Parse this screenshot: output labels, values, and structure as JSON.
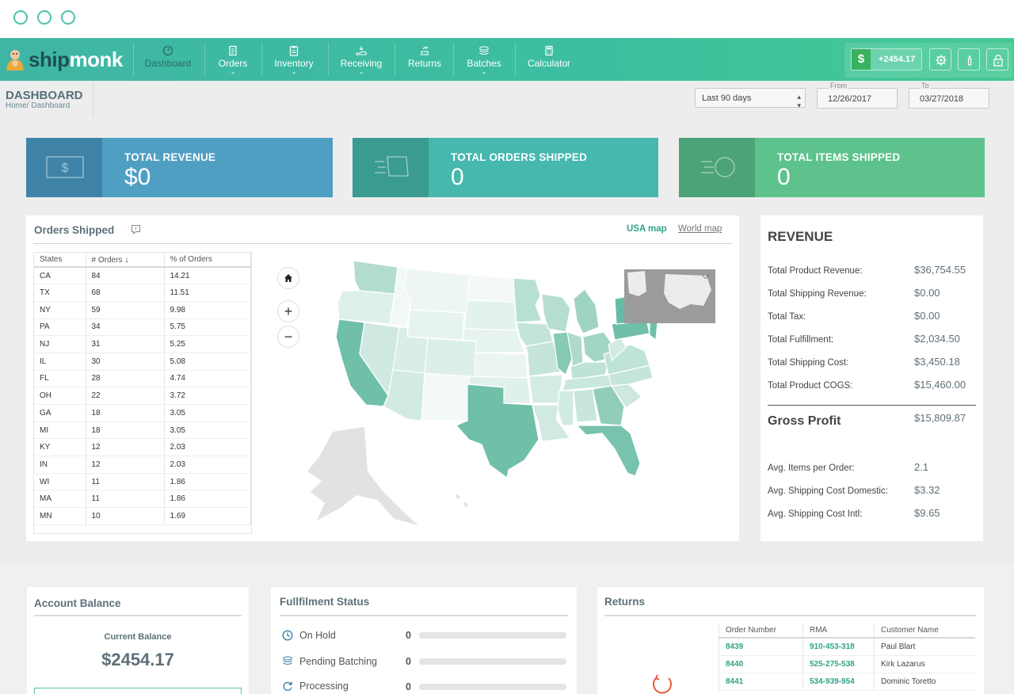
{
  "window": {
    "controls": [
      "close",
      "minimize",
      "maximize"
    ]
  },
  "brand": {
    "name_dark": "ship",
    "name_light": "monk"
  },
  "nav": {
    "items": [
      {
        "label": "Dashboard",
        "icon": "dashboard-gauge-icon",
        "active": true,
        "dropdown": false
      },
      {
        "label": "Orders",
        "icon": "document-icon",
        "active": false,
        "dropdown": true
      },
      {
        "label": "Inventory",
        "icon": "clipboard-icon",
        "active": false,
        "dropdown": true
      },
      {
        "label": "Receiving",
        "icon": "hand-receive-icon",
        "active": false,
        "dropdown": true
      },
      {
        "label": "Returns",
        "icon": "return-box-icon",
        "active": false,
        "dropdown": true
      },
      {
        "label": "Batches",
        "icon": "stack-icon",
        "active": false,
        "dropdown": true
      },
      {
        "label": "Calculator",
        "icon": "calculator-icon",
        "active": false,
        "dropdown": false
      }
    ],
    "balance": "+2454.17",
    "balance_symbol": "$"
  },
  "header": {
    "title": "DASHBOARD",
    "breadcrumb_home": "Home/",
    "breadcrumb_current": " Dashboard",
    "range": "Last 90 days",
    "from_label": "From",
    "from": "12/26/2017",
    "to_label": "To",
    "to": "03/27/2018"
  },
  "kpis": {
    "revenue": {
      "title": "TOTAL REVENUE",
      "value": "$0"
    },
    "orders": {
      "title": "TOTAL ORDERS SHIPPED",
      "value": "0"
    },
    "items": {
      "title": "TOTAL ITEMS SHIPPED",
      "value": "0"
    }
  },
  "orders_shipped": {
    "title": "Orders Shipped",
    "tab_usa": "USA map",
    "tab_world": "World map",
    "columns": [
      "States",
      "# Orders",
      "% of Orders"
    ],
    "rows": [
      [
        "CA",
        "84",
        "14.21"
      ],
      [
        "TX",
        "68",
        "11.51"
      ],
      [
        "NY",
        "59",
        "9.98"
      ],
      [
        "PA",
        "34",
        "5.75"
      ],
      [
        "NJ",
        "31",
        "5.25"
      ],
      [
        "IL",
        "30",
        "5.08"
      ],
      [
        "FL",
        "28",
        "4.74"
      ],
      [
        "OH",
        "22",
        "3.72"
      ],
      [
        "GA",
        "18",
        "3.05"
      ],
      [
        "MI",
        "18",
        "3.05"
      ],
      [
        "KY",
        "12",
        "2.03"
      ],
      [
        "IN",
        "12",
        "2.03"
      ],
      [
        "WI",
        "11",
        "1.86"
      ],
      [
        "MA",
        "11",
        "1.86"
      ],
      [
        "MN",
        "10",
        "1.69"
      ]
    ]
  },
  "revenue": {
    "title": "REVENUE",
    "rows": [
      {
        "label": "Total Product Revenue:",
        "value": "$36,754.55"
      },
      {
        "label": "Total Shipping Revenue:",
        "value": "$0.00"
      },
      {
        "label": "Total Tax:",
        "value": "$0.00"
      },
      {
        "label": "Total Fulfillment:",
        "value": "$2,034.50"
      },
      {
        "label": "Total Shipping Cost:",
        "value": "$3,450.18"
      },
      {
        "label": "Total Product COGS:",
        "value": "$15,460.00"
      }
    ],
    "gross_label": "Gross Profit",
    "gross_value": "$15,809.87",
    "avg_rows": [
      {
        "label": "Avg. Items per Order:",
        "value": "2.1"
      },
      {
        "label": "Avg. Shipping Cost Domestic:",
        "value": "$3.32"
      },
      {
        "label": "Avg. Shipping Cost Intl:",
        "value": "$9.65"
      }
    ]
  },
  "account": {
    "title": "Account Balance",
    "current_label": "Current Balance",
    "current_value": "$2454.17"
  },
  "fulfillment": {
    "title": "Fullfilment Status",
    "rows": [
      {
        "label": "On Hold",
        "count": "0",
        "icon": "clock-icon"
      },
      {
        "label": "Pending Batching",
        "count": "0",
        "icon": "stack-icon"
      },
      {
        "label": "Processing",
        "count": "0",
        "icon": "refresh-icon"
      }
    ]
  },
  "returns": {
    "title": "Returns",
    "columns": [
      "Order Number",
      "RMA",
      "Customer Name"
    ],
    "rows": [
      [
        "8439",
        "910-453-318",
        "Paul Blart"
      ],
      [
        "8440",
        "525-275-538",
        "Kirk Lazarus"
      ],
      [
        "8441",
        "534-939-954",
        "Dominic Toretto"
      ]
    ]
  },
  "colors": {
    "nav_start": "#3fb6a5",
    "nav_end": "#45c994",
    "kpi_revenue": "#4f9fc3",
    "kpi_orders": "#46b8ae",
    "kpi_items": "#5dc28c",
    "map_high": "#5fb8a1",
    "accent_link": "#2fa387"
  }
}
